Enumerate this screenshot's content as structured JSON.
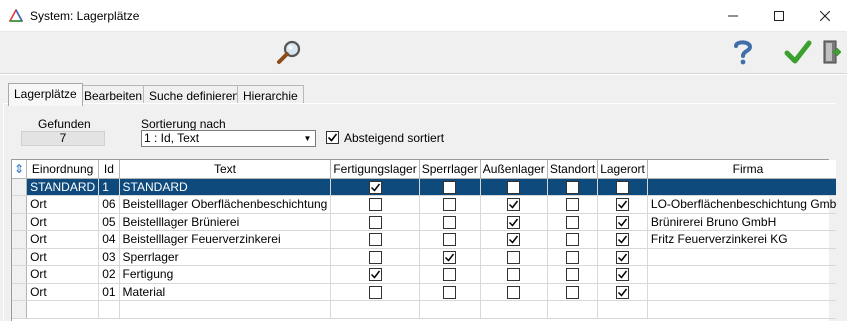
{
  "window": {
    "title": "System: Lagerplätze",
    "minimize_label": "–",
    "maximize_label": "☐",
    "close_label": "✕"
  },
  "toolbar": {
    "search_icon": "magnifier-icon",
    "help_icon": "question-icon",
    "ok_icon": "checkmark-icon",
    "exit_icon": "exit-door-icon"
  },
  "tabs": [
    {
      "label": "Lagerplätze",
      "active": true
    },
    {
      "label": "Bearbeiten",
      "active": false
    },
    {
      "label": "Suche definieren",
      "active": false
    },
    {
      "label": "Hierarchie",
      "active": false
    }
  ],
  "filter": {
    "found_label": "Gefunden",
    "found_value": "7",
    "sort_label": "Sortierung nach",
    "sort_value": "1 : Id, Text",
    "descending_label": "Absteigend sortiert",
    "descending_checked": true
  },
  "table": {
    "columns": [
      "Einordnung",
      "Id",
      "Text",
      "Fertigungslager",
      "Sperrlager",
      "Außenlager",
      "Standort",
      "Lagerort",
      "Firma"
    ],
    "rows": [
      {
        "einordnung": "STANDARD",
        "id": "1",
        "text": "STANDARD",
        "fertigung": true,
        "sperr": false,
        "aussen": false,
        "standort": false,
        "lagerort": false,
        "firma": "",
        "selected": true
      },
      {
        "einordnung": "Ort",
        "id": "06",
        "text": "Beistelllager Oberflächenbeschichtung",
        "fertigung": false,
        "sperr": false,
        "aussen": true,
        "standort": false,
        "lagerort": true,
        "firma": "LO-Oberflächenbeschichtung GmbH",
        "selected": false
      },
      {
        "einordnung": "Ort",
        "id": "05",
        "text": "Beistelllager Brünierei",
        "fertigung": false,
        "sperr": false,
        "aussen": true,
        "standort": false,
        "lagerort": true,
        "firma": "Brünirerei Bruno GmbH",
        "selected": false
      },
      {
        "einordnung": "Ort",
        "id": "04",
        "text": "Beistelllager Feuerverzinkerei",
        "fertigung": false,
        "sperr": false,
        "aussen": true,
        "standort": false,
        "lagerort": true,
        "firma": "Fritz Feuerverzinkerei KG",
        "selected": false
      },
      {
        "einordnung": "Ort",
        "id": "03",
        "text": "Sperrlager",
        "fertigung": false,
        "sperr": true,
        "aussen": false,
        "standort": false,
        "lagerort": true,
        "firma": "",
        "selected": false
      },
      {
        "einordnung": "Ort",
        "id": "02",
        "text": "Fertigung",
        "fertigung": true,
        "sperr": false,
        "aussen": false,
        "standort": false,
        "lagerort": true,
        "firma": "",
        "selected": false
      },
      {
        "einordnung": "Ort",
        "id": "01",
        "text": "Material",
        "fertigung": false,
        "sperr": false,
        "aussen": false,
        "standort": false,
        "lagerort": true,
        "firma": "",
        "selected": false
      }
    ]
  },
  "colors": {
    "selection": "#0f4a7d",
    "check_green": "#3aa02e",
    "panel_bg": "#f0f0f0"
  }
}
